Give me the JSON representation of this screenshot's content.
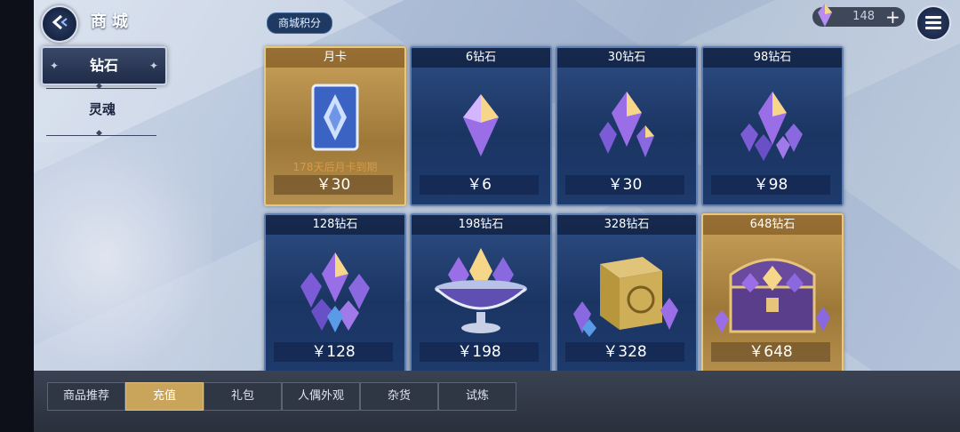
{
  "header": {
    "title": "商城",
    "points_tab": "商城积分",
    "currency_amount": "148"
  },
  "side_menu": {
    "active": "钻石",
    "items": [
      "灵魂"
    ]
  },
  "cards": [
    {
      "name": "月卡",
      "price": "￥30",
      "note": "178天后月卡到期",
      "style": "gold"
    },
    {
      "name": "6钻石",
      "price": "￥6",
      "style": "blue"
    },
    {
      "name": "30钻石",
      "price": "￥30",
      "style": "blue"
    },
    {
      "name": "98钻石",
      "price": "￥98",
      "style": "blue"
    },
    {
      "name": "128钻石",
      "price": "￥128",
      "style": "blue"
    },
    {
      "name": "198钻石",
      "price": "￥198",
      "style": "blue"
    },
    {
      "name": "328钻石",
      "price": "￥328",
      "style": "blue"
    },
    {
      "name": "648钻石",
      "price": "￥648",
      "style": "gold"
    }
  ],
  "tabs": [
    "商品推荐",
    "充值",
    "礼包",
    "人偶外观",
    "杂货",
    "试炼"
  ],
  "active_tab": "充值",
  "colors": {
    "gold": "#c9a55c",
    "blue_card": "#1b3563"
  }
}
